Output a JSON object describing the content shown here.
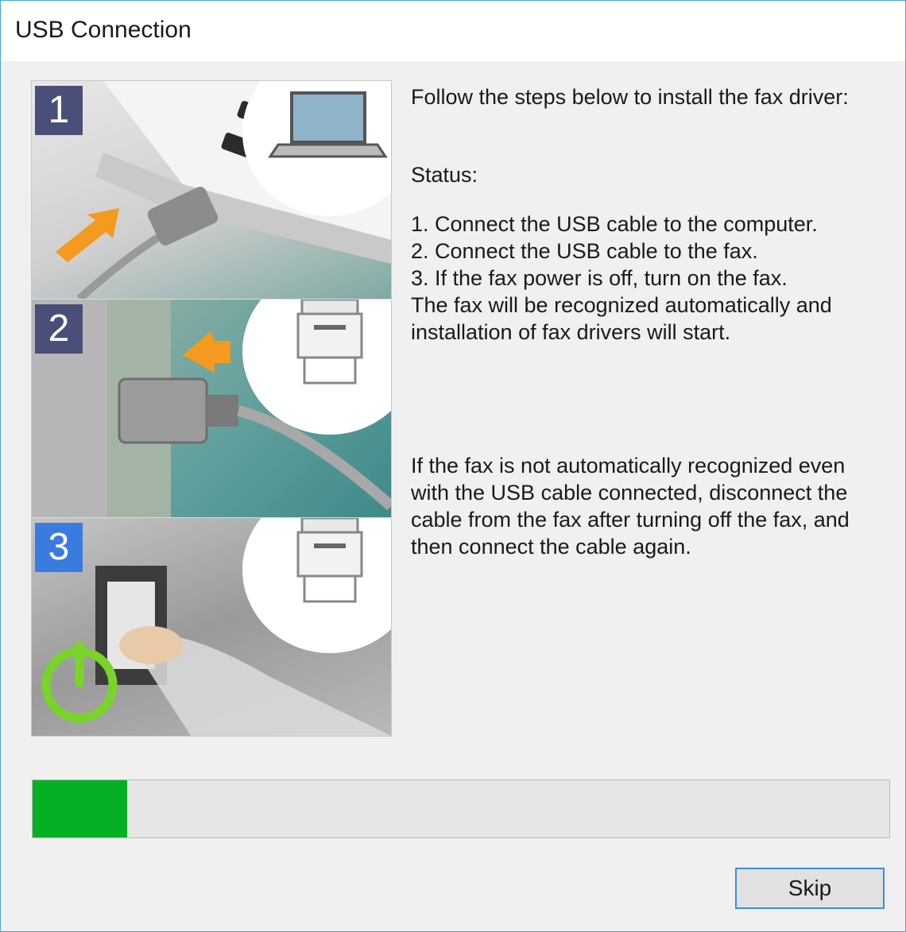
{
  "window": {
    "title": "USB Connection"
  },
  "illustration": {
    "steps": [
      {
        "number": "1",
        "badge_color": "#4a4f7a"
      },
      {
        "number": "2",
        "badge_color": "#4a4f7a"
      },
      {
        "number": "3",
        "badge_color": "#3a7be0"
      }
    ],
    "arrow_color": "#f39a1f",
    "power_icon_color": "#7ad32b"
  },
  "content": {
    "intro": "Follow the steps below to install the fax driver:",
    "status_label": "Status:",
    "steps": [
      "1. Connect the USB cable to the computer.",
      "2. Connect the USB cable to the fax.",
      "3. If the fax power is off, turn on the fax."
    ],
    "steps_note_1": "The fax will be recognized automatically and",
    "steps_note_2": "installation of fax drivers will start.",
    "help_lines": [
      "If the fax is not automatically recognized even",
      "with the USB cable connected, disconnect the",
      "cable from the fax after turning off the fax, and",
      "then connect the cable again."
    ]
  },
  "progress": {
    "value_percent": 11,
    "color": "#06b025"
  },
  "buttons": {
    "skip_label": "Skip"
  }
}
